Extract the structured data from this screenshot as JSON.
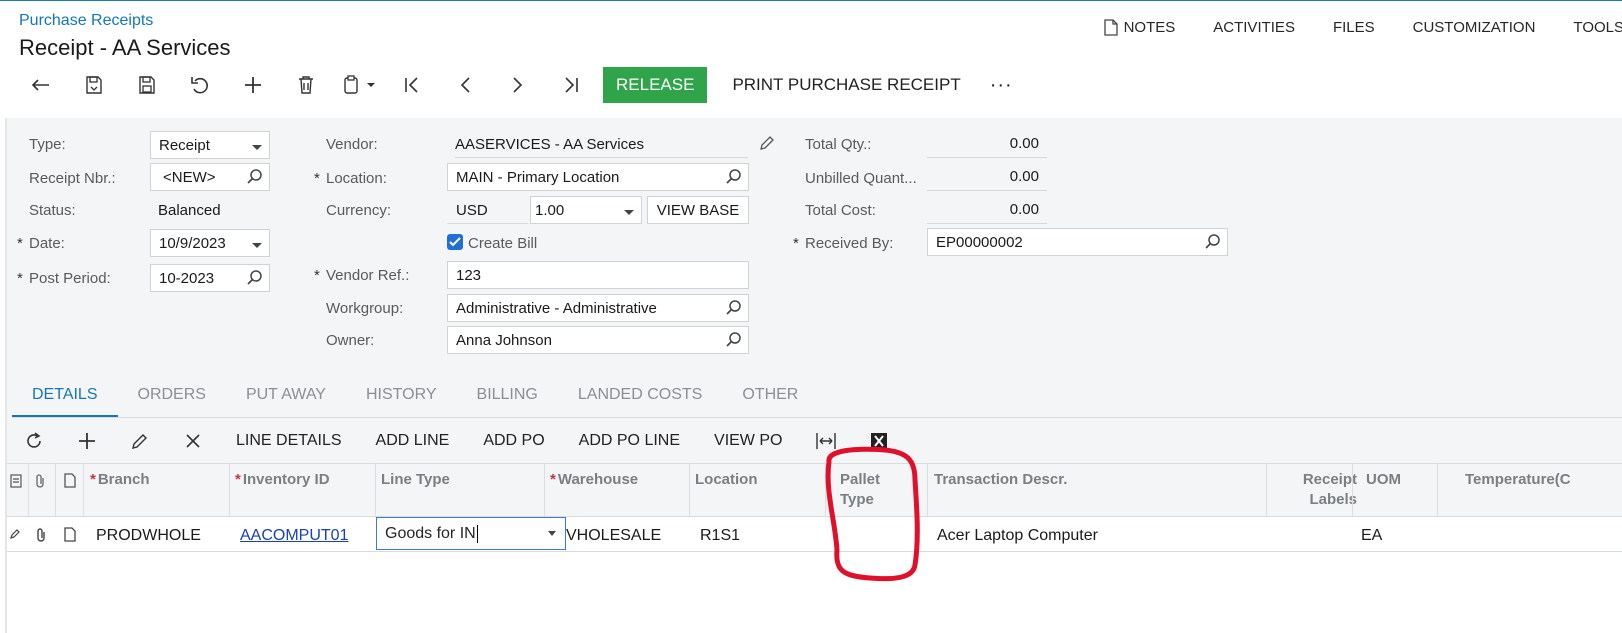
{
  "header": {
    "breadcrumb": "Purchase Receipts",
    "title": "Receipt - AA Services",
    "links": [
      "NOTES",
      "ACTIVITIES",
      "FILES",
      "CUSTOMIZATION",
      "TOOLS"
    ]
  },
  "toolbar": {
    "release": "RELEASE",
    "print": "PRINT PURCHASE RECEIPT",
    "more": "···"
  },
  "form": {
    "type_label": "Type:",
    "type_value": "Receipt",
    "receipt_label": "Receipt Nbr.:",
    "receipt_value": "<NEW>",
    "status_label": "Status:",
    "status_value": "Balanced",
    "date_label": "Date:",
    "date_value": "10/9/2023",
    "period_label": "Post Period:",
    "period_value": "10-2023",
    "vendor_label": "Vendor:",
    "vendor_value": "AASERVICES - AA Services",
    "location_label": "Location:",
    "location_value": "MAIN - Primary Location",
    "currency_label": "Currency:",
    "currency_value": "USD",
    "rate_value": "1.00",
    "view_base": "VIEW BASE",
    "create_bill": "Create Bill",
    "vendor_ref_label": "Vendor Ref.:",
    "vendor_ref_value": "123",
    "workgroup_label": "Workgroup:",
    "workgroup_value": "Administrative - Administrative",
    "owner_label": "Owner:",
    "owner_value": "Anna Johnson",
    "total_qty_label": "Total Qty.:",
    "total_qty_value": "0.00",
    "unbilled_label": "Unbilled Quant...",
    "unbilled_value": "0.00",
    "total_cost_label": "Total Cost:",
    "total_cost_value": "0.00",
    "received_by_label": "Received By:",
    "received_by_value": "EP00000002"
  },
  "tabs": [
    "DETAILS",
    "ORDERS",
    "PUT AWAY",
    "HISTORY",
    "BILLING",
    "LANDED COSTS",
    "OTHER"
  ],
  "grid_toolbar": [
    "LINE DETAILS",
    "ADD LINE",
    "ADD PO",
    "ADD PO LINE",
    "VIEW PO"
  ],
  "grid": {
    "columns": {
      "branch": "Branch",
      "inventory": "Inventory ID",
      "line_type": "Line Type",
      "warehouse": "Warehouse",
      "location": "Location",
      "pallet1": "Pallet",
      "pallet2": "Type",
      "descr": "Transaction Descr.",
      "receipt1": "Receipt",
      "receipt2": "Labels",
      "uom": "UOM",
      "temp": "Temperature(C"
    },
    "row": {
      "branch": "PRODWHOLE",
      "inventory": "AACOMPUT01",
      "line_type": "Goods for IN",
      "warehouse": "VHOLESALE",
      "location": "R1S1",
      "descr": "Acer Laptop Computer",
      "uom": "EA"
    }
  },
  "colors": {
    "accent": "#1477b8",
    "release": "#30a44a",
    "annotation": "#e0102a"
  }
}
